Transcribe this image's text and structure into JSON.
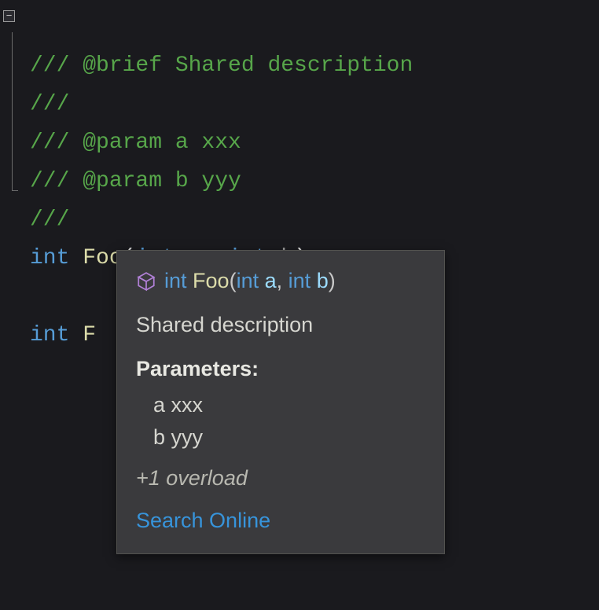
{
  "code": {
    "lines": [
      {
        "type": "comment",
        "text": "/// @brief Shared description"
      },
      {
        "type": "comment",
        "text": "///"
      },
      {
        "type": "comment",
        "text": "/// @param a xxx"
      },
      {
        "type": "comment",
        "text": "/// @param b yyy"
      },
      {
        "type": "comment",
        "text": "///"
      },
      {
        "type": "decl",
        "return_kw": "int",
        "name": "Foo",
        "p1_kw": "int",
        "p1_name": "a",
        "sep": ", ",
        "p2_kw": "int",
        "p2_name": "b",
        "tail": ");"
      },
      {
        "type": "blank",
        "text": ""
      },
      {
        "type": "partial",
        "return_kw": "int",
        "name_partial": "F"
      }
    ]
  },
  "fold": {
    "glyph": "−"
  },
  "tooltip": {
    "sig": {
      "return_kw": "int",
      "name": "Foo",
      "open": "(",
      "p1_kw": "int",
      "p1_name": "a",
      "sep": ", ",
      "p2_kw": "int",
      "p2_name": "b",
      "close": ")"
    },
    "description": "Shared description",
    "parameters_label": "Parameters:",
    "params": [
      {
        "text": "a xxx"
      },
      {
        "text": "b yyy"
      }
    ],
    "overload_text": "+1 overload",
    "search_link": "Search Online"
  },
  "icons": {
    "intellisense_cube": "cube-icon"
  },
  "colors": {
    "comment": "#57A64A",
    "keyword": "#569CD6",
    "function": "#DCDCAA",
    "param_hint": "#9CDCFE",
    "link": "#3794db",
    "tooltip_bg": "#3a3a3d"
  }
}
